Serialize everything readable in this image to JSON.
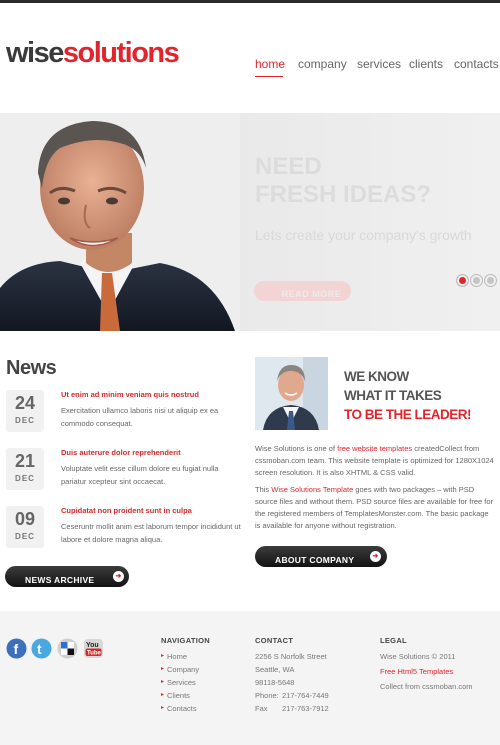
{
  "header": {
    "logo_part1": "wise",
    "logo_part2": "solutions",
    "nav": [
      {
        "label": "home",
        "active": true
      },
      {
        "label": "company"
      },
      {
        "label": "services"
      },
      {
        "label": "clients"
      },
      {
        "label": "contacts"
      }
    ]
  },
  "slider": {
    "heading_line1": "NEED",
    "heading_line2": "FRESH IDEAS?",
    "subheading": "Lets create your company's growth",
    "button_label": "READ MORE",
    "active_slide": 1,
    "slide_count": 3
  },
  "news": {
    "title": "News",
    "items": [
      {
        "day": "24",
        "month": "DEC",
        "headline": "Ut enim ad minim veniam quis nostrud",
        "text": "Exercitation ullamco laboris nisi ut aliquip ex ea commodo consequat."
      },
      {
        "day": "21",
        "month": "DEC",
        "headline": "Duis auterure dolor reprehenderit",
        "text": "Voluptate velit esse cillum dolore eu fugiat nulla pariatur xcepteur sint occaecat."
      },
      {
        "day": "09",
        "month": "DEC",
        "headline": "Cupidatat non proident sunt in culpa",
        "text": "Ceseruntr mollit anim est laborum tempor incididunt ut labore et dolore magna aliqua."
      }
    ],
    "archive_button": "NEWS ARCHIVE"
  },
  "leader": {
    "line1": "WE KNOW",
    "line2": "WHAT IT TAKES",
    "line3": "TO BE THE LEADER!",
    "p1_a": "Wise Solutions is one of ",
    "p1_link": "free website templates",
    "p1_b": " createdCollect from cssmoban.com team. This website template is optimized for 1280X1024 screen resolution. It is also XHTML & CSS valid.",
    "p2_a": "This ",
    "p2_link": "Wise Solutions Template",
    "p2_b": " goes with two packages – with PSD source files and without them. PSD source files are available for free for the registered members of TemplatesMonster.com. The basic package is available for anyone without registration.",
    "about_button": "ABOUT COMPANY"
  },
  "footer": {
    "social": [
      "facebook-icon",
      "twitter-icon",
      "delicious-icon",
      "youtube-icon"
    ],
    "navigation_title": "NAVIGATION",
    "navigation": [
      "Home",
      "Company",
      "Services",
      "Clients",
      "Contacts"
    ],
    "contact_title": "CONTACT",
    "address1": "2256 S Norfolk Street",
    "address2": "Seattle, WA",
    "zip": "98118-5648",
    "phone_label": "Phone:",
    "phone": "217-764-7449",
    "fax_label": "Fax",
    "fax": "217-763-7912",
    "legal_title": "LEGAL",
    "copyright": "Wise Solutions © 2011",
    "templates_link": "Free Html5 Templates",
    "collect": "Collect from cssmoban.com"
  },
  "colors": {
    "accent": "#e1252d",
    "dark": "#2a2a2a",
    "footer_bg": "#f4f4f4"
  }
}
